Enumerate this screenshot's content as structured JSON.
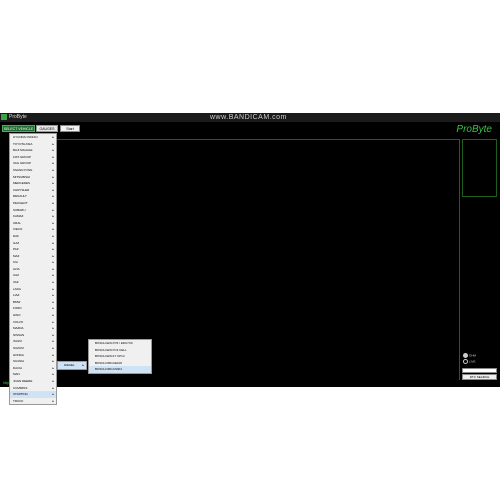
{
  "window": {
    "title": "ProByte",
    "watermark": "www.BANDICAM.com"
  },
  "tabs": [
    {
      "label": "SELECT VEHICLE"
    },
    {
      "label": "GAUGES"
    }
  ],
  "toolbar": {
    "start_label": "Start"
  },
  "logo": "ProByte",
  "side": {
    "radio1": "OHM",
    "radio2": "LIVE",
    "button_label": "DTC SEARCH"
  },
  "status": {
    "text": "https://probyte.com"
  },
  "menu": {
    "items": [
      "HYUNDAI INDIAN",
      "TOYOTA ASIA",
      "BAJI MAHALE",
      "FIAT GROUP",
      "VAG GROUP",
      "SSANGYONG",
      "MITSUBISHI",
      "MERCEDES",
      "CHRYSLER",
      "RENAULT",
      "PEUGEOT",
      "SUBARU",
      "KAMAZ",
      "URAL",
      "IVECO",
      "DAF",
      "GAZ",
      "PAZ",
      "MAZ",
      "KIA",
      "AVIA",
      "UAZ",
      "VAZ",
      "LADA",
      "LIAZ",
      "BMW",
      "FORD",
      "HINO",
      "VOLVO",
      "MAZDA",
      "NISSAN",
      "ISUZU",
      "SUZUKI",
      "HONDA",
      "SCANIA",
      "DACIA",
      "MAN",
      "JOHN DEERE",
      "CUMMINS",
      "STARTING",
      "TRUCK"
    ]
  },
  "submenu1": {
    "item": "DIESEL"
  },
  "submenu2": {
    "items": [
      "BOSCH EDC7C5 / EDC7C6",
      "BOSCH EDC7C3 CELL",
      "BOSCH EDC17 CP14",
      "BOSCH MD1CE100",
      "BOSCH MD1CS001"
    ]
  }
}
